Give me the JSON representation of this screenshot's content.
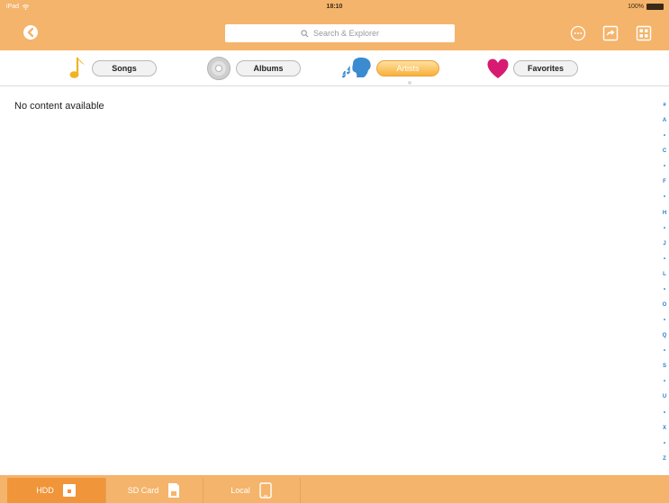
{
  "status_bar": {
    "device": "iPad",
    "time": "18:10",
    "battery": "100%"
  },
  "nav": {
    "search_placeholder": "Search & Explorer"
  },
  "categories": [
    {
      "label": "Songs",
      "icon": "music-note-icon",
      "active": false
    },
    {
      "label": "Albums",
      "icon": "disc-icon",
      "active": false
    },
    {
      "label": "Artists",
      "icon": "singer-icon",
      "active": true
    },
    {
      "label": "Favorites",
      "icon": "heart-icon",
      "active": false
    }
  ],
  "content": {
    "empty_message": "No content available"
  },
  "alpha_index": [
    "#",
    "A",
    "•",
    "C",
    "•",
    "F",
    "•",
    "H",
    "•",
    "J",
    "•",
    "L",
    "•",
    "O",
    "•",
    "Q",
    "•",
    "S",
    "•",
    "U",
    "•",
    "X",
    "•",
    "Z"
  ],
  "bottom_tabs": [
    {
      "label": "HDD",
      "icon": "hdd-icon",
      "active": true
    },
    {
      "label": "SD Card",
      "icon": "sd-card-icon",
      "active": false
    },
    {
      "label": "Local",
      "icon": "tablet-icon",
      "active": false
    }
  ],
  "colors": {
    "accent_orange": "#f5b46b",
    "active_tab_orange": "#f0953a",
    "index_blue": "#2f7ac6",
    "heart_pink": "#d81b72",
    "note_yellow": "#f0b323"
  }
}
